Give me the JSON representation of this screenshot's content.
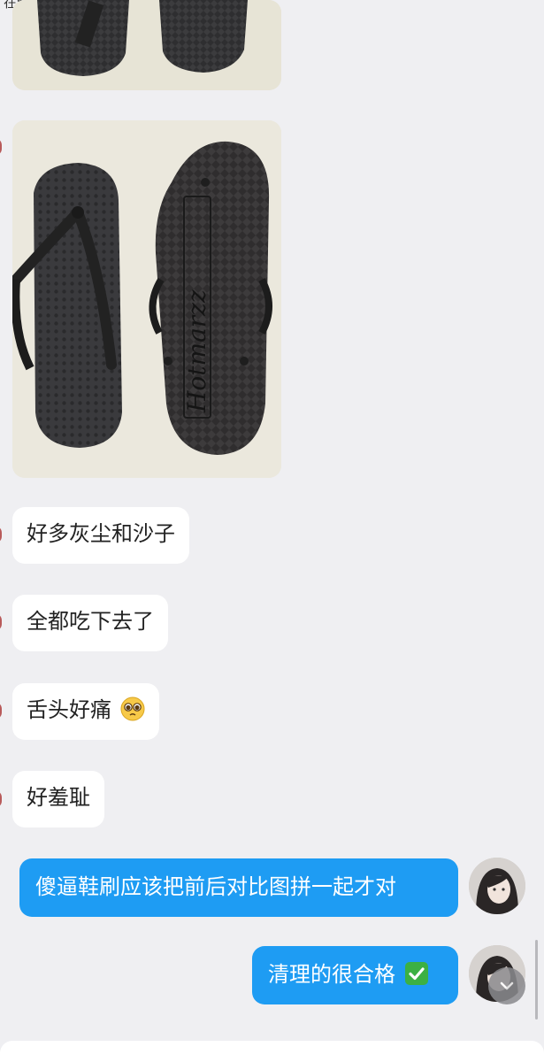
{
  "status_bar": {
    "text": "在线 · WiFi ▾"
  },
  "messages": [
    {
      "id": "m1",
      "side": "in",
      "type": "image",
      "subject": "flip-flop soles, cropped"
    },
    {
      "id": "m2",
      "side": "in",
      "type": "image",
      "subject": "black flip-flops, top strap and sole"
    },
    {
      "id": "m3",
      "side": "in",
      "type": "text",
      "text": "好多灰尘和沙子"
    },
    {
      "id": "m4",
      "side": "in",
      "type": "text",
      "text": "全都吃下去了"
    },
    {
      "id": "m5",
      "side": "in",
      "type": "text",
      "text": "舌头好痛"
    },
    {
      "id": "m6",
      "side": "in",
      "type": "text",
      "text": "好羞耻"
    },
    {
      "id": "m7",
      "side": "out",
      "type": "text",
      "text": "傻逼鞋刷应该把前后对比图拼一起才对"
    },
    {
      "id": "m8",
      "side": "out",
      "type": "text",
      "text": "清理的很合格"
    }
  ],
  "sole_brand_text": "Hotmarzz",
  "colors": {
    "outgoing_bubble": "#1e9cf3",
    "incoming_bubble": "#ffffff",
    "background": "#efeff2"
  },
  "icons": [
    "pleading-face-emoji",
    "check-mark-emoji",
    "chevron-down-icon"
  ]
}
